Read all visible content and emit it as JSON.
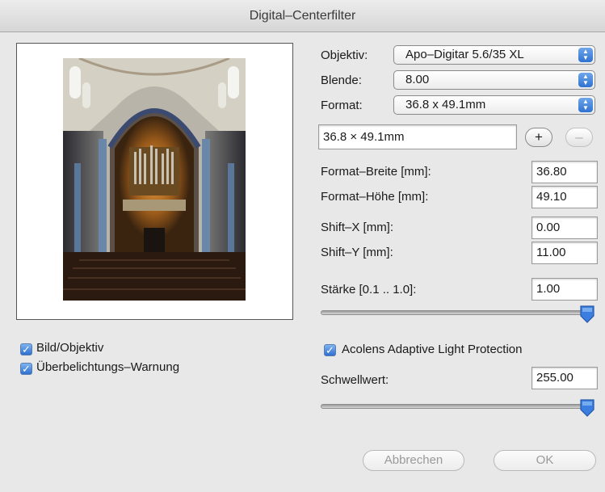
{
  "window": {
    "title": "Digital–Centerfilter"
  },
  "lens": {
    "objektiv_label": "Objektiv:",
    "objektiv_value": "Apo–Digitar 5.6/35 XL",
    "blende_label": "Blende:",
    "blende_value": "8.00",
    "format_label": "Format:",
    "format_value": "36.8 x 49.1mm",
    "format_text": "36.8 × 49.1mm",
    "add_symbol": "+",
    "remove_symbol": "–"
  },
  "params": {
    "breite_label": "Format–Breite [mm]:",
    "breite_value": "36.80",
    "hoehe_label": "Format–Höhe [mm]:",
    "hoehe_value": "49.10",
    "shiftx_label": "Shift–X [mm]:",
    "shiftx_value": "0.00",
    "shifty_label": "Shift–Y [mm]:",
    "shifty_value": "11.00",
    "staerke_label": "Stärke  [0.1 .. 1.0]:",
    "staerke_value": "1.00",
    "staerke_slider_level": 1.0
  },
  "options": {
    "bild_label": "Bild/Objektiv",
    "warnung_label": "Überbelichtungs–Warnung",
    "acolens_label": "Acolens Adaptive Light Protection",
    "check_mark": "✓"
  },
  "threshold": {
    "label": "Schwellwert:",
    "value": "255.00",
    "slider_level": 1.0
  },
  "buttons": {
    "cancel": "Abbrechen",
    "ok": "OK"
  },
  "icons": {
    "popup_arrows": "up-down-arrows-icon",
    "slider_knob": "slider-knob-icon"
  },
  "colors": {
    "accent": "#2f72d2",
    "background": "#e8e8e8"
  }
}
